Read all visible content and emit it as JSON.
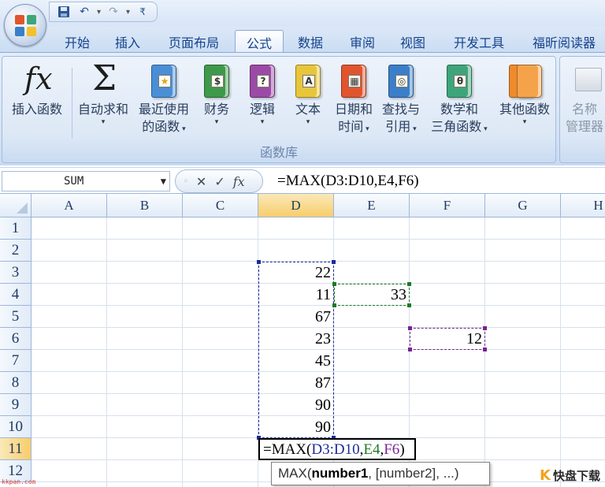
{
  "qat": {
    "save_icon": "save-icon",
    "undo_icon": "undo-icon",
    "redo_icon": "redo-icon",
    "customize_icon": "customize-qat-icon"
  },
  "tabs": [
    {
      "label": "开始"
    },
    {
      "label": "插入"
    },
    {
      "label": "页面布局"
    },
    {
      "label": "公式"
    },
    {
      "label": "数据"
    },
    {
      "label": "审阅"
    },
    {
      "label": "视图"
    },
    {
      "label": "开发工具"
    },
    {
      "label": "福昕阅读器"
    }
  ],
  "active_tab": "公式",
  "ribbon": {
    "group_funclib_caption": "函数库",
    "buttons": [
      {
        "line1": "插入函数",
        "line2": ""
      },
      {
        "line1": "自动求和",
        "line2": ""
      },
      {
        "line1": "最近使用",
        "line2": "的函数"
      },
      {
        "line1": "财务",
        "line2": ""
      },
      {
        "line1": "逻辑",
        "line2": ""
      },
      {
        "line1": "文本",
        "line2": ""
      },
      {
        "line1": "日期和",
        "line2": "时间"
      },
      {
        "line1": "查找与",
        "line2": "引用"
      },
      {
        "line1": "数学和",
        "line2": "三角函数"
      },
      {
        "line1": "其他函数",
        "line2": ""
      }
    ],
    "names_button": {
      "line1": "名称",
      "line2": "管理器"
    },
    "colors": {
      "financial": "#3e9a4a",
      "logical": "#9b4aa5",
      "text": "#e8c63a",
      "datetime": "#e0552e",
      "lookup": "#3a7fc8",
      "math": "#3ea57a",
      "more": "#f08a2a",
      "recent": "#4a8fd6"
    }
  },
  "formula_bar": {
    "name_box": "SUM",
    "cancel_icon": "✕",
    "enter_icon": "✓",
    "fx_icon": "fx",
    "formula": "=MAX(D3:D10,E4,F6)"
  },
  "sheet": {
    "columns": [
      "A",
      "B",
      "C",
      "D",
      "E",
      "F",
      "G",
      "H"
    ],
    "rows": [
      "1",
      "2",
      "3",
      "4",
      "5",
      "6",
      "7",
      "8",
      "9",
      "10",
      "11",
      "12"
    ],
    "selected_column": "D",
    "selected_row": "11",
    "cells": {
      "D3": "22",
      "D4": "11",
      "D5": "67",
      "D6": "23",
      "D7": "45",
      "D8": "87",
      "D9": "90",
      "D10": "90",
      "E4": "33",
      "F6": "12"
    },
    "edit_cell": {
      "prefix": "=MAX(",
      "ref1": "D3:D10",
      "sep1": ",",
      "ref2": "E4",
      "sep2": ",",
      "ref3": "F6",
      "suffix": ")"
    },
    "ref_colors": {
      "ref1": "#1c2b9a",
      "ref2": "#1e7a23",
      "ref3": "#7a2392"
    },
    "tooltip": {
      "fn": "MAX(",
      "arg1": "number1",
      "rest": ", [number2], ...)"
    }
  },
  "watermarks": {
    "left": "kkpan.com",
    "right_logo": "K",
    "right_text": "快盘下载"
  }
}
